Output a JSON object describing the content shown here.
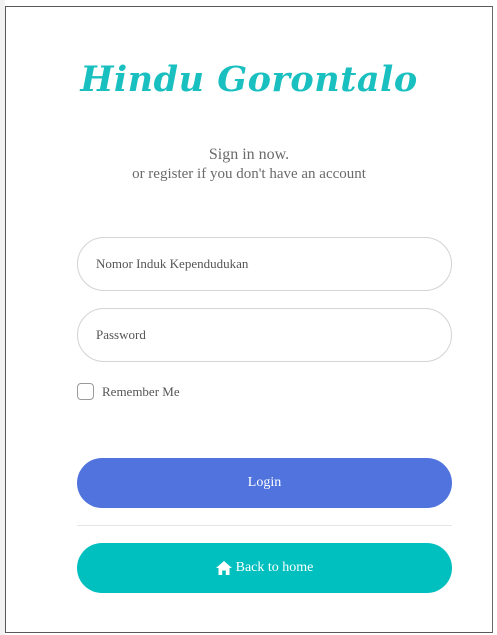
{
  "brand": {
    "logo_text": "Hindu Gorontalo",
    "logo_color": "#1abfbf"
  },
  "intro": {
    "line1": "Sign in now.",
    "line2": "or register if you don't have an account"
  },
  "form": {
    "nik_placeholder": "Nomor Induk Kependudukan",
    "password_placeholder": "Password",
    "remember_label": "Remember Me",
    "remember_checked": false
  },
  "buttons": {
    "login_label": "Login",
    "login_color": "#5073dd",
    "home_label": "Back to home",
    "home_icon": "home-icon",
    "home_color": "#00bfbf"
  }
}
